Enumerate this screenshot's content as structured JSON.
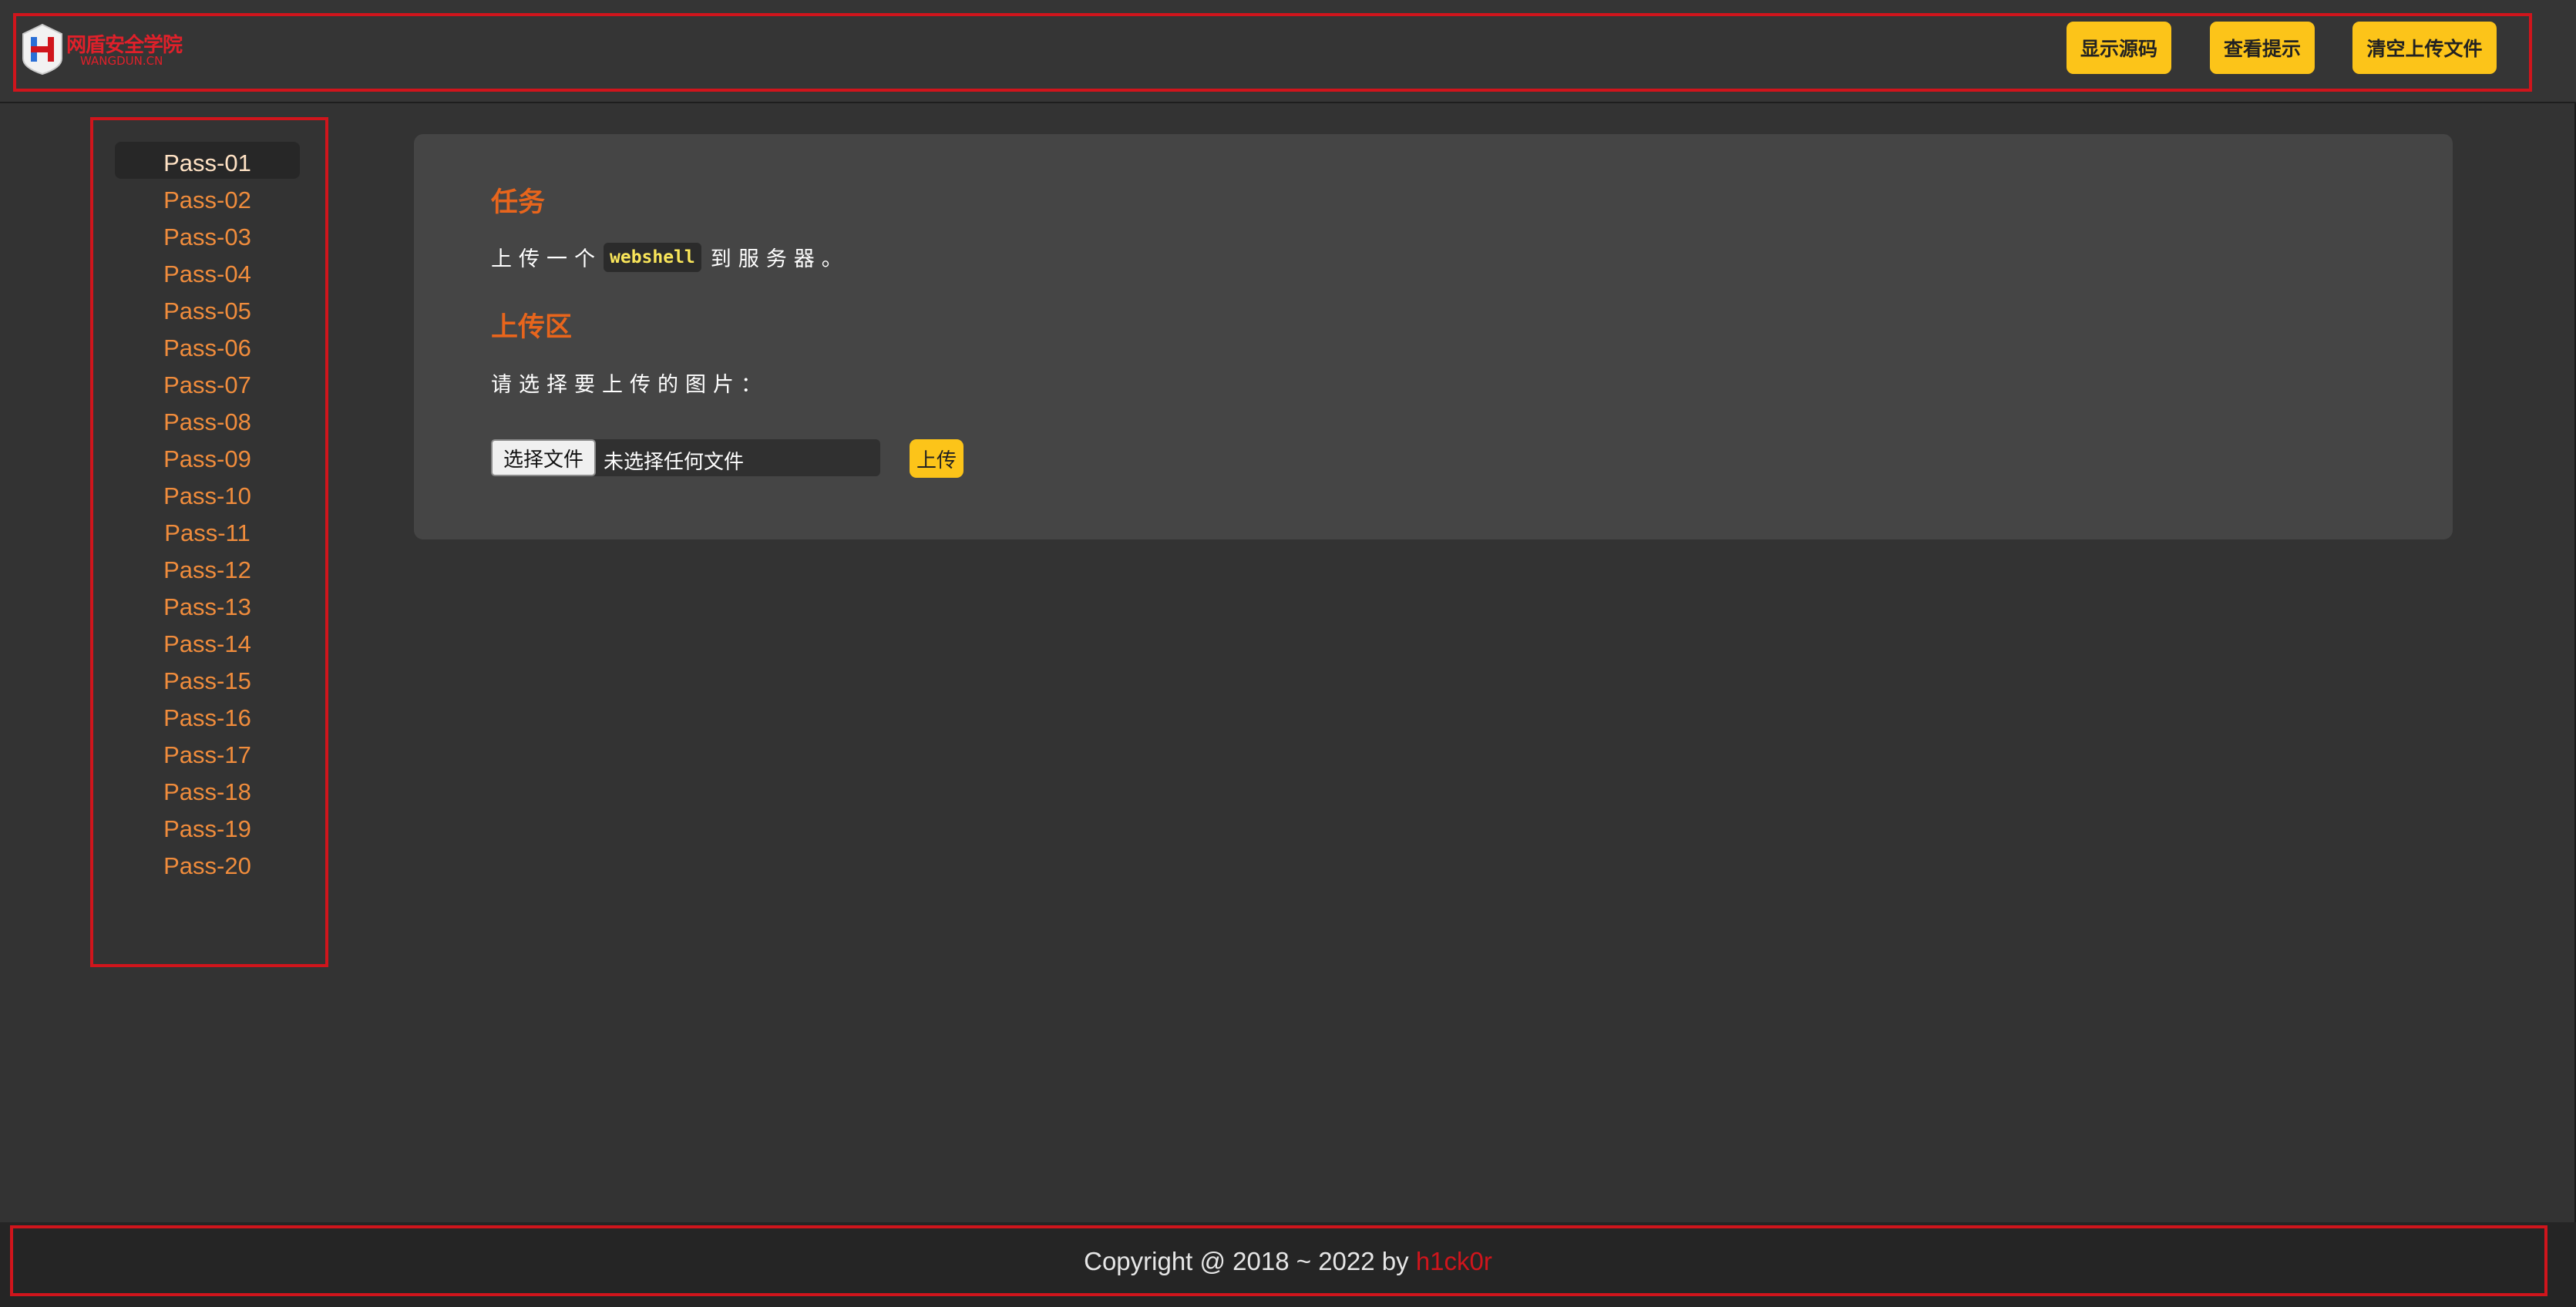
{
  "header": {
    "logo_cn": "网盾安全学院",
    "logo_en": "WANGDUN.CN",
    "buttons": [
      "显示源码",
      "查看提示",
      "清空上传文件"
    ]
  },
  "sidebar": {
    "active": "Pass-01",
    "items": [
      "Pass-01",
      "Pass-02",
      "Pass-03",
      "Pass-04",
      "Pass-05",
      "Pass-06",
      "Pass-07",
      "Pass-08",
      "Pass-09",
      "Pass-10",
      "Pass-11",
      "Pass-12",
      "Pass-13",
      "Pass-14",
      "Pass-15",
      "Pass-16",
      "Pass-17",
      "Pass-18",
      "Pass-19",
      "Pass-20"
    ]
  },
  "main": {
    "task_heading": "任务",
    "task_text_before": "上传一个",
    "task_code": "webshell",
    "task_text_after": "到服务器。",
    "upload_heading": "上传区",
    "select_label": "请选择要上传的图片：",
    "file_button": "选择文件",
    "file_status": "未选择任何文件",
    "upload_button": "上传"
  },
  "footer": {
    "copyright": "Copyright @ 2018 ~ 2022 by",
    "author": "h1ck0r"
  },
  "colors": {
    "background": "#333333",
    "accent_yellow": "#fcc419",
    "heading_orange": "#e8651c",
    "nav_orange": "#f08c3c",
    "highlight_red": "#d0151c"
  }
}
